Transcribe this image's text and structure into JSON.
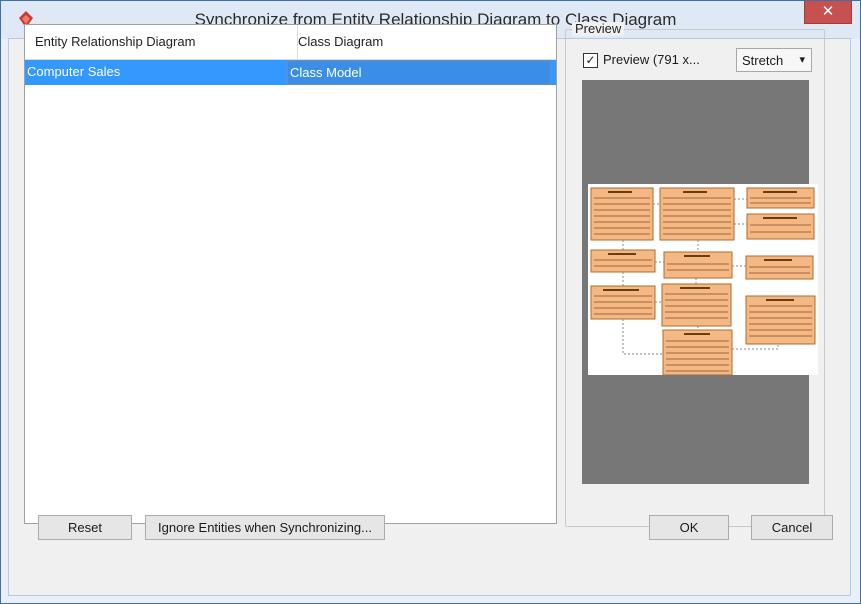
{
  "dialog": {
    "title": "Synchronize from Entity Relationship Diagram to Class Diagram",
    "close_symbol": "✕"
  },
  "table": {
    "columns": [
      "Entity Relationship Diagram",
      "Class Diagram"
    ],
    "rows": [
      {
        "erd": "Computer Sales",
        "class_diagram": "Class Model",
        "selected": true
      }
    ]
  },
  "preview": {
    "group_label": "Preview",
    "checkbox_label": "Preview  (791 x...",
    "checkbox_checked": true,
    "mode": "Stretch"
  },
  "buttons": {
    "reset": "Reset",
    "ignore": "Ignore Entities when Synchronizing...",
    "ok": "OK",
    "cancel": "Cancel"
  },
  "colors": {
    "selection": "#3399ff",
    "entity": "#f3b884",
    "canvas_bg": "#777777"
  }
}
